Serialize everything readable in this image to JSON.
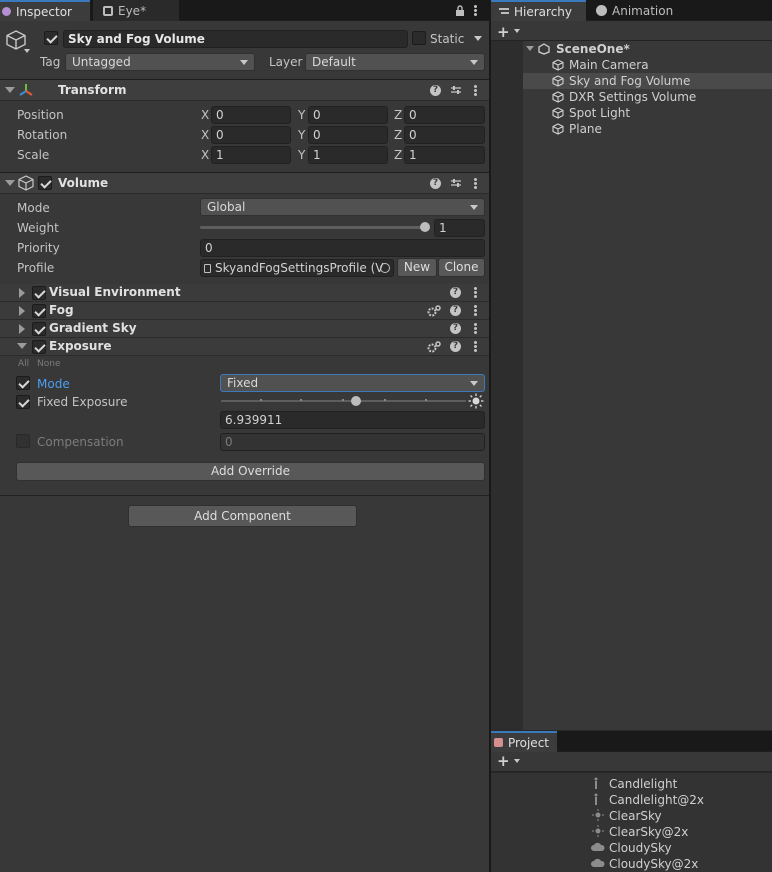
{
  "inspector_tabs": {
    "inspector": "Inspector",
    "eye": "Eye*"
  },
  "gameobject": {
    "name": "Sky and Fog Volume",
    "static_label": "Static",
    "tag_label": "Tag",
    "tag_value": "Untagged",
    "layer_label": "Layer",
    "layer_value": "Default"
  },
  "transform": {
    "title": "Transform",
    "position_label": "Position",
    "rotation_label": "Rotation",
    "scale_label": "Scale",
    "axis": {
      "x": "X",
      "y": "Y",
      "z": "Z"
    },
    "position": {
      "x": "0",
      "y": "0",
      "z": "0"
    },
    "rotation": {
      "x": "0",
      "y": "0",
      "z": "0"
    },
    "scale": {
      "x": "1",
      "y": "1",
      "z": "1"
    }
  },
  "volume": {
    "title": "Volume",
    "mode_label": "Mode",
    "mode_value": "Global",
    "weight_label": "Weight",
    "weight_value": "1",
    "weight_fraction": 1.0,
    "priority_label": "Priority",
    "priority_value": "0",
    "profile_label": "Profile",
    "profile_value": "SkyandFogSettingsProfile (V",
    "new_label": "New",
    "clone_label": "Clone",
    "overrides": [
      {
        "label": "Visual Environment"
      },
      {
        "label": "Fog"
      },
      {
        "label": "Gradient Sky"
      },
      {
        "label": "Exposure"
      }
    ],
    "all_label": "All",
    "none_label": "None",
    "exposure": {
      "mode_label": "Mode",
      "mode_value": "Fixed",
      "fixed_label": "Fixed Exposure",
      "fixed_value": "6.939911",
      "slider_fraction": 0.55,
      "compensation_label": "Compensation",
      "compensation_value": "0"
    },
    "add_override": "Add Override"
  },
  "add_component": "Add Component",
  "hierarchy": {
    "tab": "Hierarchy",
    "animation_tab": "Animation",
    "scene": "SceneOne*",
    "items": [
      "Main Camera",
      "Sky and Fog Volume",
      "DXR Settings Volume",
      "Spot Light",
      "Plane"
    ]
  },
  "project": {
    "tab": "Project",
    "items": [
      "Candlelight",
      "Candlelight@2x",
      "ClearSky",
      "ClearSky@2x",
      "CloudySky",
      "CloudySky@2x"
    ]
  },
  "colors": {
    "accent": "#3a79bb",
    "mode_label_active": "#4c9ef0"
  }
}
